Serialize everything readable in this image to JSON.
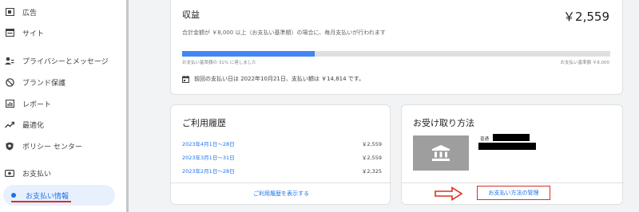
{
  "sidebar": {
    "items": [
      {
        "label": "広告",
        "icon": "ad-icon"
      },
      {
        "label": "サイト",
        "icon": "site-icon"
      },
      {
        "label": "プライバシーとメッセージ",
        "icon": "privacy-icon"
      },
      {
        "label": "ブランド保護",
        "icon": "block-icon"
      },
      {
        "label": "レポート",
        "icon": "report-icon"
      },
      {
        "label": "最適化",
        "icon": "trend-icon"
      },
      {
        "label": "ポリシー センター",
        "icon": "policy-icon"
      },
      {
        "label": "お支払い",
        "icon": "payments-icon"
      },
      {
        "label": "お支払い情報",
        "icon": "active-dot",
        "active": true
      }
    ]
  },
  "earnings": {
    "title": "収益",
    "amount": "￥2,559",
    "description": "合計金額が ￥8,000 以上（お支払い基準額）の場合に、毎月支払いが行われます",
    "progress_fraction": 0.31,
    "progress_label": "お支払い基準額の 31% に達しました",
    "threshold_label": "お支払い基準額 ￥8,000",
    "last_payment": "前回の支払い日は 2022年10月21日、支払い額は ￥14,814 です。"
  },
  "history": {
    "title": "ご利用履歴",
    "rows": [
      {
        "date": "2023年4月1日〜28日",
        "amount": "￥2,559"
      },
      {
        "date": "2023年3月1日〜31日",
        "amount": "￥2,559"
      },
      {
        "date": "2023年2月1日〜28日",
        "amount": "￥2,325"
      }
    ],
    "view_link": "ご利用履歴を表示する"
  },
  "payment_method": {
    "title": "お受け取り方法",
    "account_type": "普通",
    "manage_link": "お支払い方法の管理"
  },
  "colors": {
    "accent": "#1a73e8",
    "progress": "#4285f4",
    "highlight": "#d93025"
  }
}
